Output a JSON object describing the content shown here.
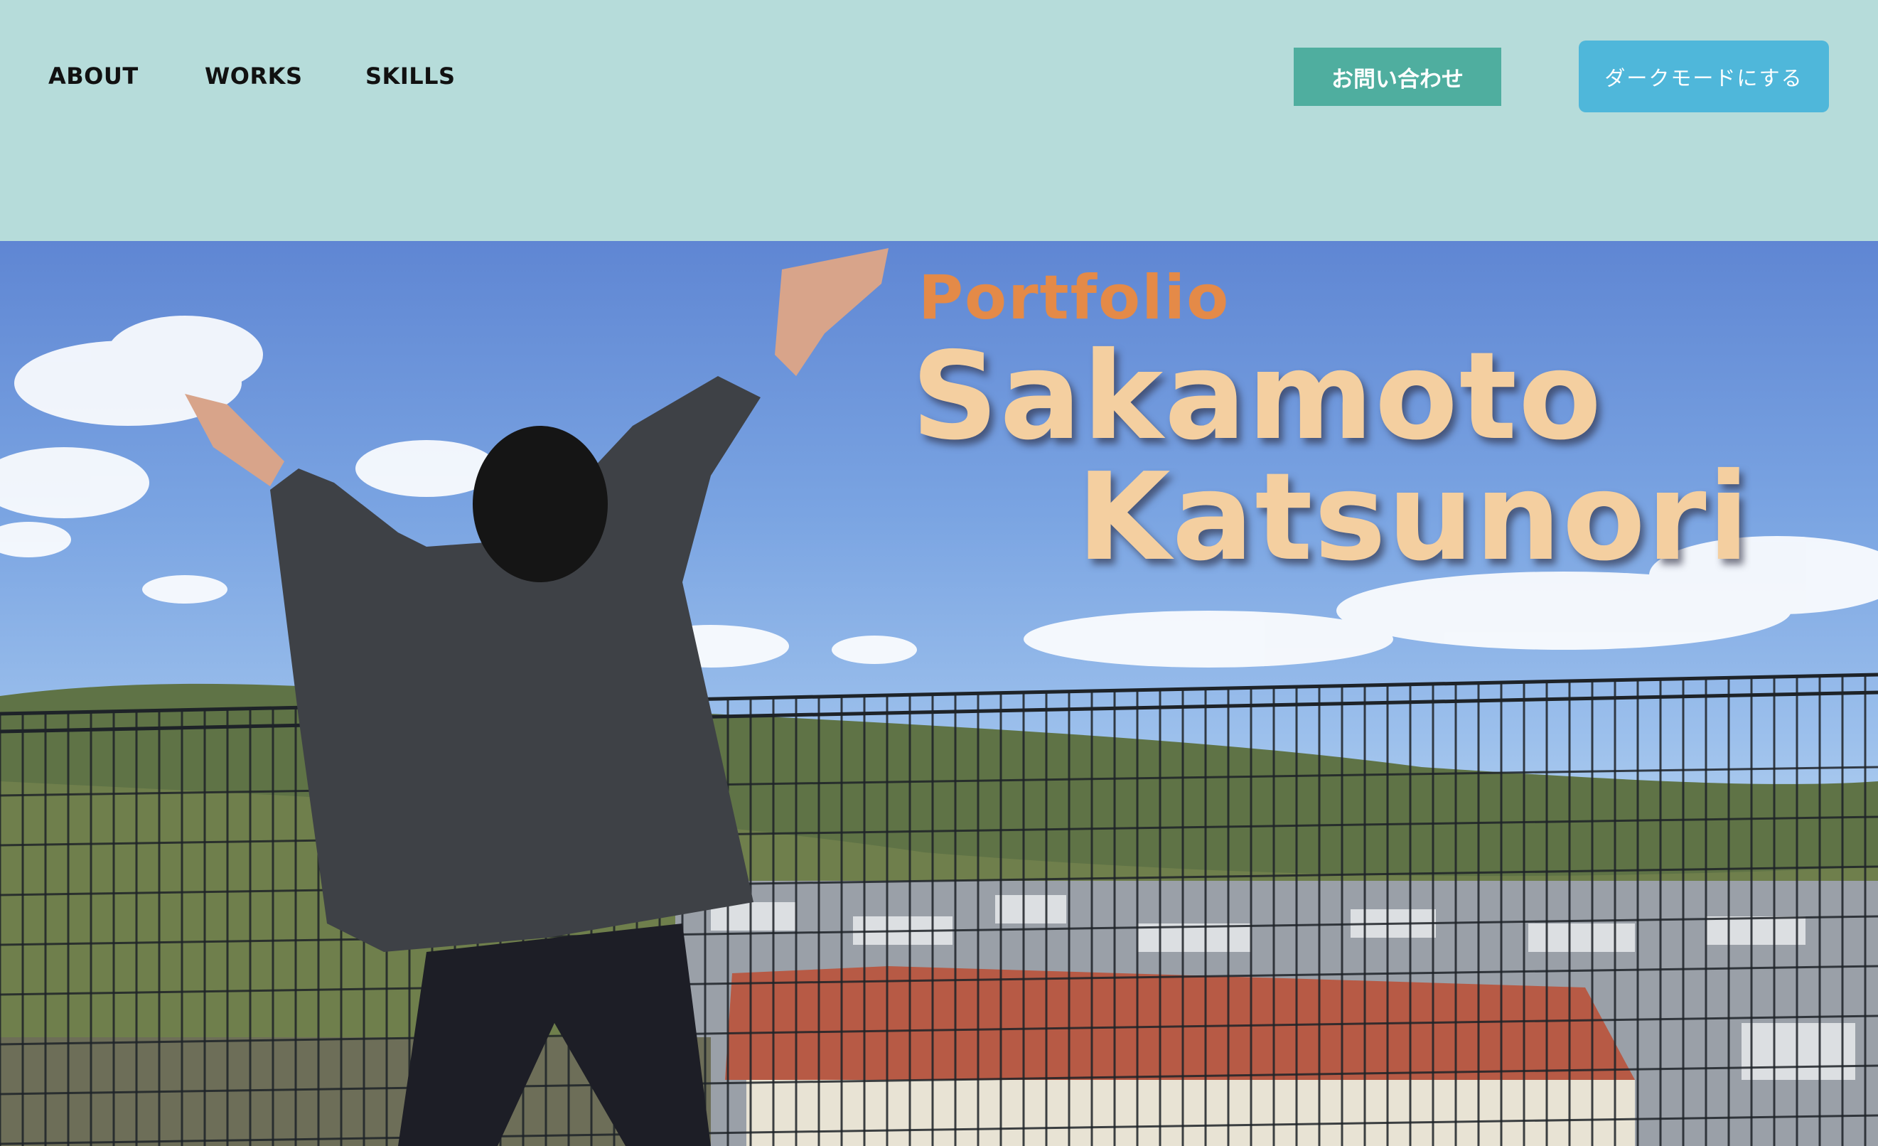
{
  "nav": {
    "items": [
      {
        "label": "ABOUT"
      },
      {
        "label": "WORKS"
      },
      {
        "label": "SKILLS"
      }
    ]
  },
  "header": {
    "contact_label": "お問い合わせ",
    "dark_mode_label": "ダークモードにする"
  },
  "hero": {
    "portfolio_label": "Portfolio",
    "name_line1": "Sakamoto",
    "name_line2": "Katsunori"
  },
  "colors": {
    "header_bg": "#b6dcda",
    "contact_bg": "#4fae9f",
    "dark_btn_bg": "#4fb7da",
    "portfolio_text": "#e48a48",
    "name_text": "#f4cfa0"
  }
}
